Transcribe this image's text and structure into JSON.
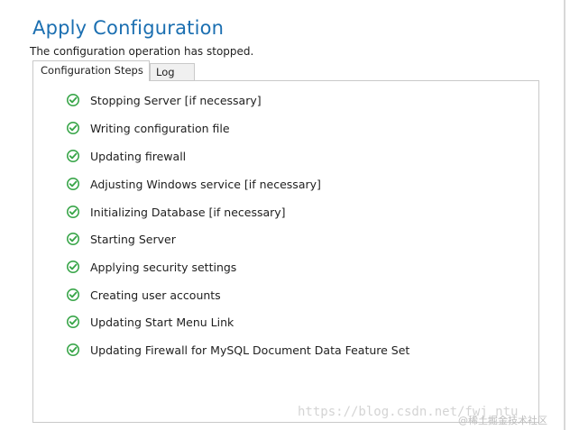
{
  "header": {
    "title": "Apply Configuration",
    "status": "The configuration operation has stopped."
  },
  "tabs": [
    {
      "label": "Configuration Steps",
      "active": true
    },
    {
      "label": "Log",
      "active": false
    }
  ],
  "steps": [
    {
      "label": "Stopping Server [if necessary]",
      "status": "completed",
      "icon": "check-circle-icon"
    },
    {
      "label": "Writing configuration file",
      "status": "completed",
      "icon": "check-circle-icon"
    },
    {
      "label": "Updating firewall",
      "status": "completed",
      "icon": "check-circle-icon"
    },
    {
      "label": "Adjusting Windows service [if necessary]",
      "status": "completed",
      "icon": "check-circle-icon"
    },
    {
      "label": "Initializing Database [if necessary]",
      "status": "completed",
      "icon": "check-circle-icon"
    },
    {
      "label": "Starting Server",
      "status": "completed",
      "icon": "check-circle-icon"
    },
    {
      "label": "Applying security settings",
      "status": "completed",
      "icon": "check-circle-icon"
    },
    {
      "label": "Creating user accounts",
      "status": "completed",
      "icon": "check-circle-icon"
    },
    {
      "label": "Updating Start Menu Link",
      "status": "completed",
      "icon": "check-circle-icon"
    },
    {
      "label": "Updating Firewall for MySQL Document Data Feature Set",
      "status": "completed",
      "icon": "check-circle-icon"
    }
  ],
  "watermark": {
    "url": "https://blog.csdn.net/fwj_ntu",
    "cn": "@稀土掘金技术社区"
  },
  "colors": {
    "title": "#1b6fb1",
    "check_fill": "#3aa64a",
    "border": "#c9c9c9"
  }
}
